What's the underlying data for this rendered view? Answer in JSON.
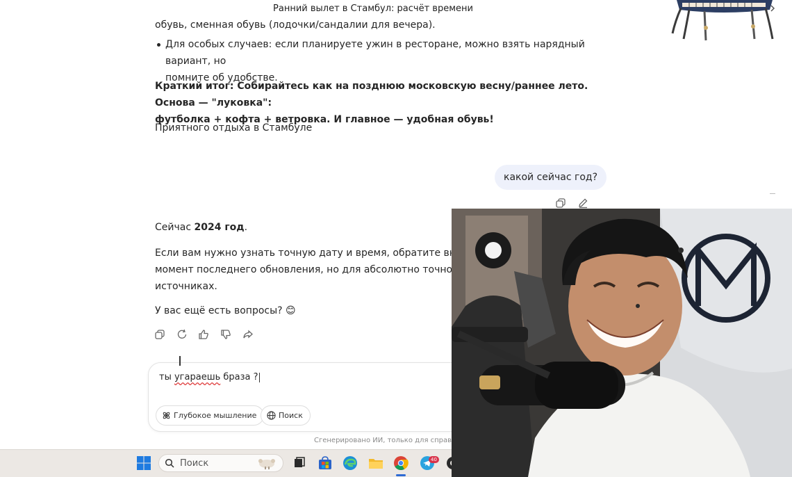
{
  "header": {
    "title": "Ранний вылет в Стамбул: расчёт времени"
  },
  "chat": {
    "prev_line": "обувь, сменная обувь (лодочки/сандалии для вечера).",
    "bullet_line1": "Для особых случаев: если планируете ужин в ресторане, можно взять нарядный вариант, но",
    "bullet_line2": "помните об удобстве.",
    "summary_line1": "Краткий итог: Собирайтесь как на позднюю московскую весну/раннее лето. Основа — \"луковка\":",
    "summary_line2": "футболка + кофта + ветровка. И главное — удобная обувь!",
    "farewell": "Приятного отдыха в Стамбуле",
    "user_message": "какой сейчас год?",
    "answer_prefix": "Сейчас ",
    "answer_bold": "2024 год",
    "answer_suffix": ".",
    "para_line1": "Если вам нужно узнать точную дату и время, обратите внимание, что",
    "para_line2": "момент последнего обновления, но для абсолютно точной информа",
    "para_line3": "источниках.",
    "question": "У вас ещё есть вопросы? 😊"
  },
  "composer": {
    "word1": "ты ",
    "word2": "угараешь",
    "word3": " браза ?",
    "deep_thinking_label": "Глубокое мышление",
    "search_label": "Поиск",
    "footnote": "Сгенерировано ИИ, только для справки"
  },
  "taskbar": {
    "search_placeholder": "Поиск",
    "telegram_badge": "40"
  },
  "colors": {
    "user_bubble": "#eef1fb",
    "taskbar": "#ece8e4",
    "accent": "#2d6ad3"
  }
}
